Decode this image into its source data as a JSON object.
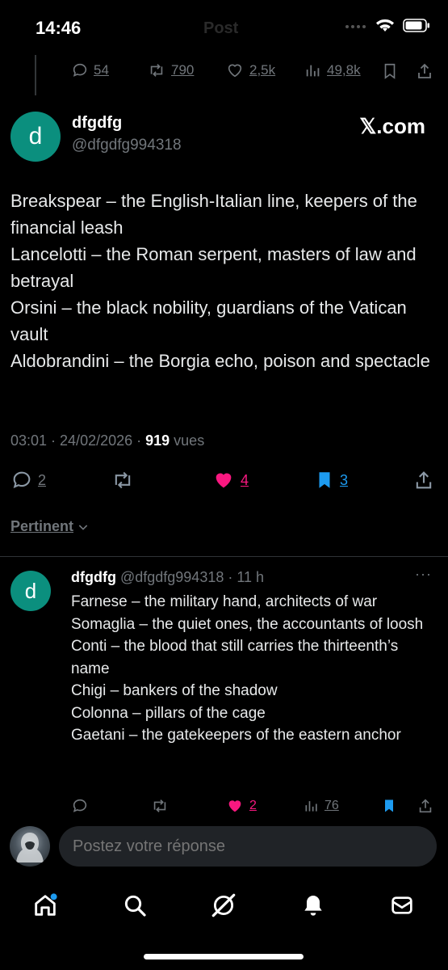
{
  "status_bar": {
    "time": "14:46",
    "ghost_title": "Post"
  },
  "prev_post_actions": {
    "replies": "54",
    "reposts": "790",
    "likes": "2,5k",
    "views": "49,8k"
  },
  "main_post": {
    "avatar_letter": "d",
    "name": "dfgdfg",
    "handle": "@dfgdfg994318",
    "brand": "𝕏.com",
    "lines": [
      "Breakspear – the English-Italian line, keepers of the financial leash",
      "Lancelotti – the Roman serpent, masters of law and betrayal",
      "Orsini – the black nobility, guardians of the Vatican vault",
      "Aldobrandini – the Borgia echo, poison and spectacle"
    ],
    "meta_time": "03:01 · 24/02/2026 · ",
    "meta_views": "919",
    "meta_views_label": " vues",
    "actions": {
      "replies": "2",
      "likes": "4",
      "bookmarks": "3"
    }
  },
  "sort_label": "Pertinent",
  "reply": {
    "avatar_letter": "d",
    "name": "dfgdfg",
    "handle_time": " @dfgdfg994318 · 11 h",
    "more": "···",
    "lines": [
      "Farnese – the military hand, architects of war",
      "Somaglia – the quiet ones, the accountants of loosh",
      "Conti – the blood that still carries the thirteenth’s name",
      "Chigi – bankers of the shadow",
      "Colonna – pillars of the cage",
      "Gaetani – the gatekeepers of the eastern anchor"
    ],
    "actions": {
      "likes": "2",
      "views": "76"
    }
  },
  "compose": {
    "placeholder": "Postez votre réponse"
  },
  "colors": {
    "like": "#f91880",
    "bookmark": "#1d9bf0",
    "avatar": "#0b8f7e",
    "muted": "#71767b"
  },
  "nav_icons": [
    "home-icon",
    "search-icon",
    "grok-icon",
    "notifications-icon",
    "messages-icon"
  ]
}
